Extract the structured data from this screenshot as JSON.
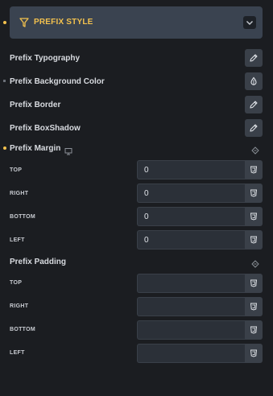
{
  "section": {
    "title": "PREFIX STYLE",
    "accent_color": "#f2c14e",
    "icons": {
      "title": "filter-icon",
      "toggle": "chevron-down-icon"
    }
  },
  "controls": {
    "typography": {
      "label": "Prefix Typography",
      "icon": "pencil-icon"
    },
    "background_color": {
      "label": "Prefix Background Color",
      "icon": "color-drop-icon"
    },
    "border": {
      "label": "Prefix Border",
      "icon": "pencil-icon"
    },
    "box_shadow": {
      "label": "Prefix BoxShadow",
      "icon": "pencil-icon"
    }
  },
  "margin": {
    "label": "Prefix Margin",
    "responsive_icon": "monitor-icon",
    "link_icon": "link-icon",
    "unit_icon": "css-unit-icon",
    "sides": [
      {
        "label": "TOP",
        "value": "0"
      },
      {
        "label": "RIGHT",
        "value": "0"
      },
      {
        "label": "BOTTOM",
        "value": "0"
      },
      {
        "label": "LEFT",
        "value": "0"
      }
    ]
  },
  "padding": {
    "label": "Prefix Padding",
    "link_icon": "link-icon",
    "unit_icon": "css-unit-icon",
    "sides": [
      {
        "label": "TOP",
        "value": ""
      },
      {
        "label": "RIGHT",
        "value": ""
      },
      {
        "label": "BOTTOM",
        "value": ""
      },
      {
        "label": "LEFT",
        "value": ""
      }
    ]
  }
}
